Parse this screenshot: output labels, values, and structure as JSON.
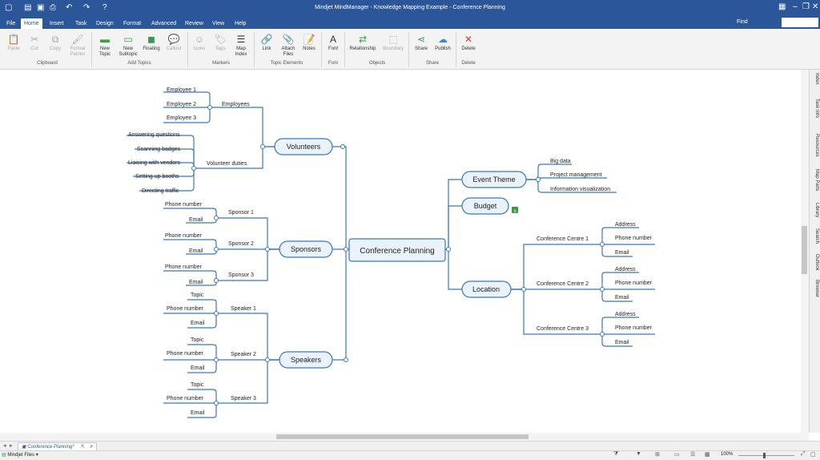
{
  "app": {
    "title": "Mindjet MindManager - Knowledge Mapping Example - Conference Planning"
  },
  "menu": {
    "tabs": [
      "File",
      "Home",
      "Insert",
      "Task",
      "Design",
      "Format",
      "Advanced",
      "Review",
      "View",
      "Help"
    ],
    "active": "Home",
    "find_label": "Find"
  },
  "ribbon": {
    "buttons": {
      "paste": "Paste",
      "cut": "Cut",
      "copy": "Copy",
      "format_painter": "Format Painter",
      "new_topic": "New Topic",
      "new_subtopic": "New Subtopic",
      "floating": "Floating",
      "callout": "Callout",
      "icons": "Icons",
      "tags": "Tags",
      "map_index": "Map Index",
      "link": "Link",
      "attach_files": "Attach Files",
      "notes": "Notes",
      "font": "Font",
      "relationship": "Relationship",
      "boundary": "Boundary",
      "share": "Share",
      "publish": "Publish",
      "delete": "Delete"
    },
    "groups": {
      "clipboard": "Clipboard",
      "add_topics": "Add Topics",
      "markers": "Markers",
      "topic_elements": "Topic Elements",
      "font": "Font",
      "objects": "Objects",
      "share": "Share",
      "delete": "Delete"
    }
  },
  "side_panel": [
    "Index",
    "Task Info",
    "Resources",
    "Map Parts",
    "Library",
    "Search",
    "Outlook",
    "Browser"
  ],
  "map": {
    "central": "Conference Planning",
    "volunteers": {
      "label": "Volunteers",
      "employees": {
        "label": "Employees",
        "children": [
          "Employee 1",
          "Employee 2",
          "Employee 3"
        ]
      },
      "duties": {
        "label": "Volunteer duties",
        "children": [
          "Answering questions",
          "Scanning badges",
          "Liaising with vendors",
          "Setting up booths",
          "Directing traffic"
        ]
      }
    },
    "sponsors": {
      "label": "Sponsors",
      "children": [
        {
          "label": "Sponsor 1",
          "items": [
            "Phone number",
            "Email"
          ]
        },
        {
          "label": "Sponsor 2",
          "items": [
            "Phone number",
            "Email"
          ]
        },
        {
          "label": "Sponsor 3",
          "items": [
            "Phone number",
            "Email"
          ]
        }
      ]
    },
    "speakers": {
      "label": "Speakers",
      "children": [
        {
          "label": "Speaker 1",
          "items": [
            "Topic",
            "Phone number",
            "Email"
          ]
        },
        {
          "label": "Speaker 2",
          "items": [
            "Topic",
            "Phone number",
            "Email"
          ]
        },
        {
          "label": "Speaker 3",
          "items": [
            "Topic",
            "Phone number",
            "Email"
          ]
        }
      ]
    },
    "event_theme": {
      "label": "Event Theme",
      "children": [
        "Big data",
        "Project management",
        "Information visualization"
      ]
    },
    "budget": {
      "label": "Budget"
    },
    "location": {
      "label": "Location",
      "children": [
        {
          "label": "Conference Centre 1",
          "items": [
            "Address",
            "Phone number",
            "Email"
          ]
        },
        {
          "label": "Conference Centre 2",
          "items": [
            "Address",
            "Phone number",
            "Email"
          ]
        },
        {
          "label": "Conference Centre 3",
          "items": [
            "Address",
            "Phone number",
            "Email"
          ]
        }
      ]
    }
  },
  "doc_tab": {
    "label": "Conference Planning*"
  },
  "status": {
    "files_label": "Mindjet Files",
    "zoom": "100%"
  },
  "colors": {
    "brand": "#2b579a",
    "topic_fill": "#eaf2fb",
    "line": "#3c78b4",
    "delete_red": "#d9342b",
    "green_icon": "#3a9a4a"
  }
}
